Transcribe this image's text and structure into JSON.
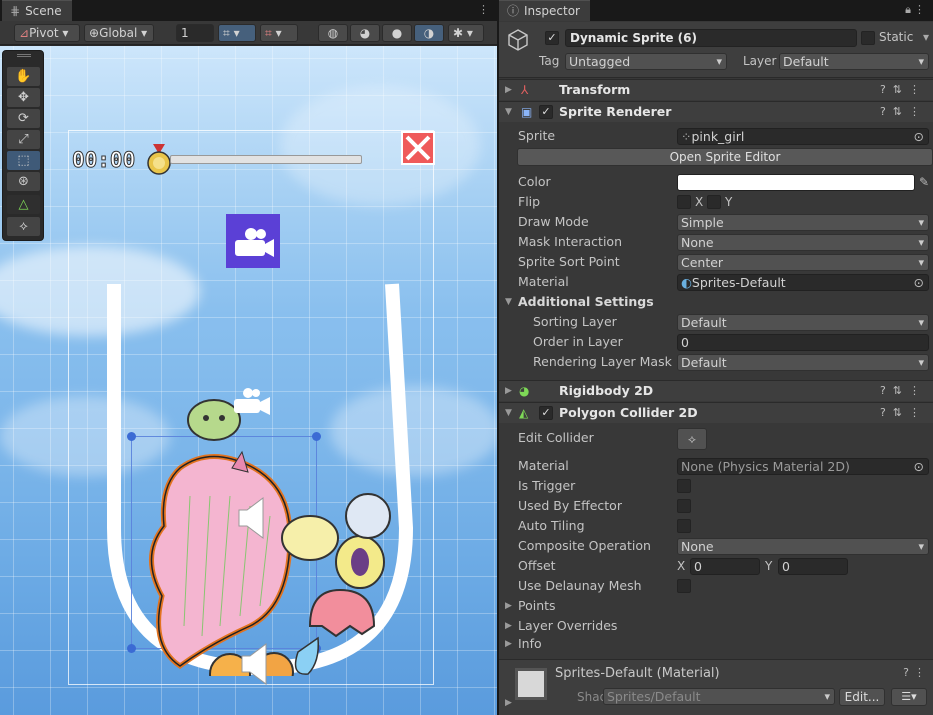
{
  "scene": {
    "tab_label": "Scene",
    "toolbar": {
      "pivot": "Pivot",
      "global": "Global",
      "grid_snap_value": "1"
    },
    "game_ui": {
      "timer": "00:00"
    }
  },
  "inspector": {
    "tab_label": "Inspector",
    "object_name": "Dynamic Sprite (6)",
    "static_label": "Static",
    "tag_label": "Tag",
    "tag_value": "Untagged",
    "layer_label": "Layer",
    "layer_value": "Default",
    "transform": {
      "title": "Transform"
    },
    "sprite_renderer": {
      "title": "Sprite Renderer",
      "sprite_label": "Sprite",
      "sprite_value": "pink_girl",
      "open_editor": "Open Sprite Editor",
      "color_label": "Color",
      "flip_label": "Flip",
      "flip_x": "X",
      "flip_y": "Y",
      "draw_mode_label": "Draw Mode",
      "draw_mode_value": "Simple",
      "mask_label": "Mask Interaction",
      "mask_value": "None",
      "sort_point_label": "Sprite Sort Point",
      "sort_point_value": "Center",
      "material_label": "Material",
      "material_value": "Sprites-Default",
      "additional_settings": "Additional Settings",
      "sorting_layer_label": "Sorting Layer",
      "sorting_layer_value": "Default",
      "order_label": "Order in Layer",
      "order_value": "0",
      "rendering_mask_label": "Rendering Layer Mask",
      "rendering_mask_value": "Default"
    },
    "rigidbody": {
      "title": "Rigidbody 2D"
    },
    "polygon_collider": {
      "title": "Polygon Collider 2D",
      "edit_collider_label": "Edit Collider",
      "material_label": "Material",
      "material_value": "None (Physics Material 2D)",
      "is_trigger_label": "Is Trigger",
      "used_by_effector_label": "Used By Effector",
      "auto_tiling_label": "Auto Tiling",
      "composite_label": "Composite Operation",
      "composite_value": "None",
      "offset_label": "Offset",
      "offset_x_label": "X",
      "offset_x": "0",
      "offset_y_label": "Y",
      "offset_y": "0",
      "delaunay_label": "Use Delaunay Mesh",
      "points_label": "Points",
      "layer_overrides_label": "Layer Overrides",
      "info_label": "Info"
    },
    "material_footer": {
      "title": "Sprites-Default (Material)",
      "shader_label": "Shader",
      "shader_value": "Sprites/Default",
      "edit_button": "Edit..."
    }
  }
}
